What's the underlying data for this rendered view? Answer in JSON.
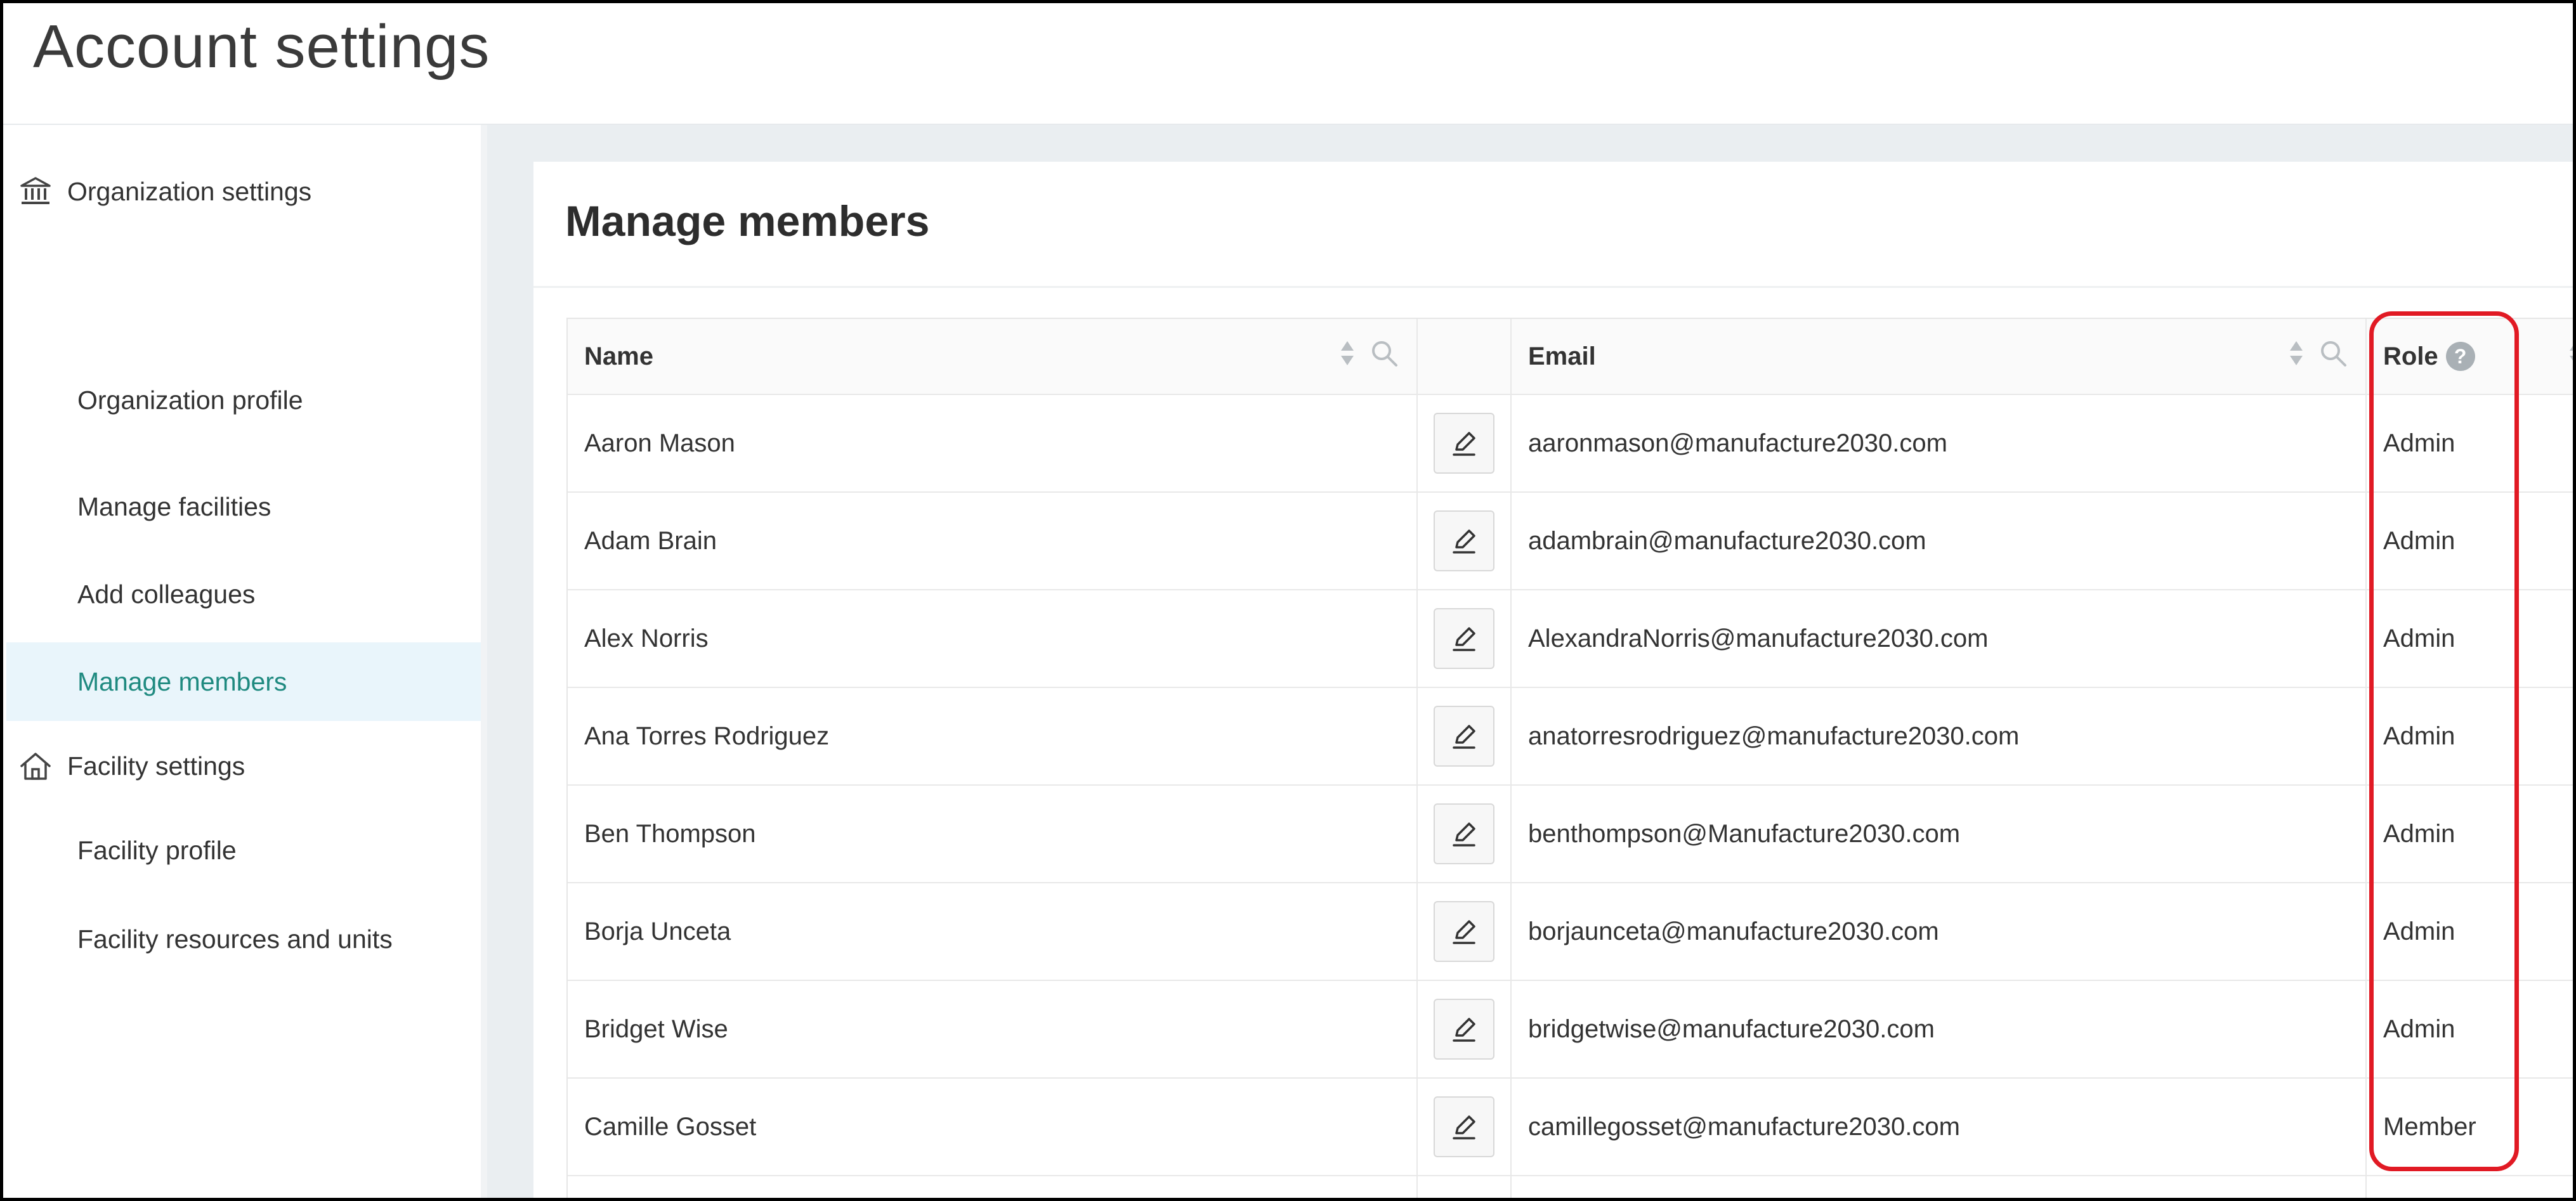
{
  "app": {
    "title": "Account settings"
  },
  "sidebar": {
    "org_section": {
      "label": "Organization settings",
      "icon": "bank-icon"
    },
    "org_items": [
      {
        "label": "Organization profile"
      },
      {
        "label": "Manage facilities"
      },
      {
        "label": "Add colleagues"
      },
      {
        "label": "Manage members",
        "active": true
      }
    ],
    "facility_section": {
      "label": "Facility settings",
      "icon": "home-icon"
    },
    "facility_items": [
      {
        "label": "Facility profile"
      },
      {
        "label": "Facility resources and units"
      }
    ]
  },
  "main": {
    "title": "Manage members",
    "table": {
      "columns": {
        "name": "Name",
        "email": "Email",
        "role": "Role"
      },
      "rows": [
        {
          "name": "Aaron Mason",
          "email": "aaronmason@manufacture2030.com",
          "role": "Admin"
        },
        {
          "name": "Adam Brain",
          "email": "adambrain@manufacture2030.com",
          "role": "Admin"
        },
        {
          "name": "Alex Norris",
          "email": "AlexandraNorris@manufacture2030.com",
          "role": "Admin"
        },
        {
          "name": "Ana Torres Rodriguez",
          "email": "anatorresrodriguez@manufacture2030.com",
          "role": "Admin"
        },
        {
          "name": "Ben Thompson",
          "email": "benthompson@Manufacture2030.com",
          "role": "Admin"
        },
        {
          "name": "Borja Unceta",
          "email": "borjaunceta@manufacture2030.com",
          "role": "Admin"
        },
        {
          "name": "Bridget Wise",
          "email": "bridgetwise@manufacture2030.com",
          "role": "Admin"
        },
        {
          "name": "Camille Gosset",
          "email": "camillegosset@manufacture2030.com",
          "role": "Member"
        }
      ]
    }
  },
  "icons": {
    "help": "?",
    "edit": "pencil-icon",
    "sort": "sort-icon",
    "search": "search-icon"
  },
  "colors": {
    "active_nav_bg": "#e9f5fb",
    "active_nav_text": "#1f8a80",
    "highlight": "#e11a24"
  }
}
